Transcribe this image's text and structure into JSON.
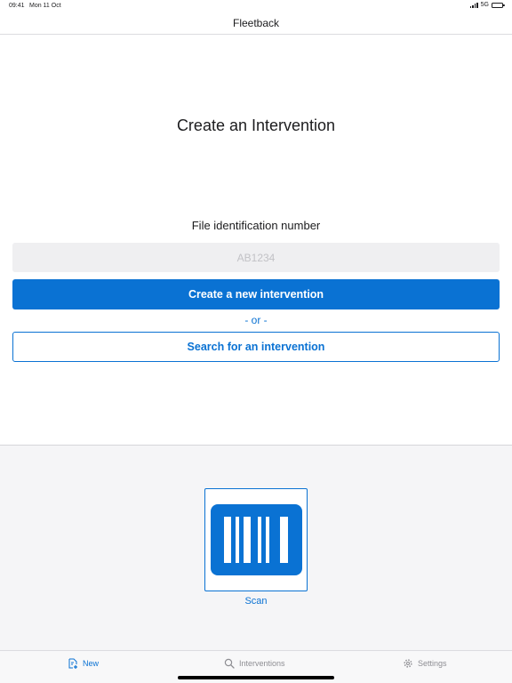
{
  "status_bar": {
    "time": "09:41",
    "date": "Mon 11 Oct",
    "network": "5G"
  },
  "nav": {
    "title": "Fleetback"
  },
  "main": {
    "heading": "Create an Intervention",
    "field_label": "File identification number",
    "field_placeholder": "AB1234",
    "field_value": "",
    "create_button": "Create a new intervention",
    "or_text": "- or -",
    "search_button": "Search for an intervention"
  },
  "scan": {
    "label": "Scan",
    "icon": "barcode-icon"
  },
  "tab_bar": {
    "tabs": [
      {
        "label": "New",
        "icon": "new-document-icon",
        "active": true
      },
      {
        "label": "Interventions",
        "icon": "search-icon",
        "active": false
      },
      {
        "label": "Settings",
        "icon": "gear-icon",
        "active": false
      }
    ]
  },
  "colors": {
    "accent": "#0a72d3",
    "inactive": "#8e8e93",
    "input_bg": "#efeff1",
    "scan_bg": "#f5f5f7"
  }
}
